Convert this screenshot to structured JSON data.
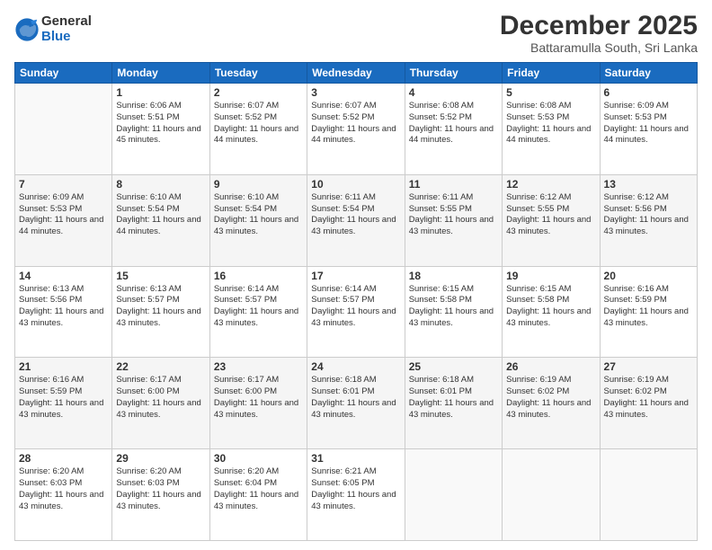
{
  "logo": {
    "general": "General",
    "blue": "Blue"
  },
  "header": {
    "month": "December 2025",
    "location": "Battaramulla South, Sri Lanka"
  },
  "days": [
    "Sunday",
    "Monday",
    "Tuesday",
    "Wednesday",
    "Thursday",
    "Friday",
    "Saturday"
  ],
  "weeks": [
    [
      {
        "day": "",
        "sunrise": "",
        "sunset": "",
        "daylight": ""
      },
      {
        "day": "1",
        "sunrise": "6:06 AM",
        "sunset": "5:51 PM",
        "daylight": "11 hours and 45 minutes."
      },
      {
        "day": "2",
        "sunrise": "6:07 AM",
        "sunset": "5:52 PM",
        "daylight": "11 hours and 44 minutes."
      },
      {
        "day": "3",
        "sunrise": "6:07 AM",
        "sunset": "5:52 PM",
        "daylight": "11 hours and 44 minutes."
      },
      {
        "day": "4",
        "sunrise": "6:08 AM",
        "sunset": "5:52 PM",
        "daylight": "11 hours and 44 minutes."
      },
      {
        "day": "5",
        "sunrise": "6:08 AM",
        "sunset": "5:53 PM",
        "daylight": "11 hours and 44 minutes."
      },
      {
        "day": "6",
        "sunrise": "6:09 AM",
        "sunset": "5:53 PM",
        "daylight": "11 hours and 44 minutes."
      }
    ],
    [
      {
        "day": "7",
        "sunrise": "6:09 AM",
        "sunset": "5:53 PM",
        "daylight": "11 hours and 44 minutes."
      },
      {
        "day": "8",
        "sunrise": "6:10 AM",
        "sunset": "5:54 PM",
        "daylight": "11 hours and 44 minutes."
      },
      {
        "day": "9",
        "sunrise": "6:10 AM",
        "sunset": "5:54 PM",
        "daylight": "11 hours and 43 minutes."
      },
      {
        "day": "10",
        "sunrise": "6:11 AM",
        "sunset": "5:54 PM",
        "daylight": "11 hours and 43 minutes."
      },
      {
        "day": "11",
        "sunrise": "6:11 AM",
        "sunset": "5:55 PM",
        "daylight": "11 hours and 43 minutes."
      },
      {
        "day": "12",
        "sunrise": "6:12 AM",
        "sunset": "5:55 PM",
        "daylight": "11 hours and 43 minutes."
      },
      {
        "day": "13",
        "sunrise": "6:12 AM",
        "sunset": "5:56 PM",
        "daylight": "11 hours and 43 minutes."
      }
    ],
    [
      {
        "day": "14",
        "sunrise": "6:13 AM",
        "sunset": "5:56 PM",
        "daylight": "11 hours and 43 minutes."
      },
      {
        "day": "15",
        "sunrise": "6:13 AM",
        "sunset": "5:57 PM",
        "daylight": "11 hours and 43 minutes."
      },
      {
        "day": "16",
        "sunrise": "6:14 AM",
        "sunset": "5:57 PM",
        "daylight": "11 hours and 43 minutes."
      },
      {
        "day": "17",
        "sunrise": "6:14 AM",
        "sunset": "5:57 PM",
        "daylight": "11 hours and 43 minutes."
      },
      {
        "day": "18",
        "sunrise": "6:15 AM",
        "sunset": "5:58 PM",
        "daylight": "11 hours and 43 minutes."
      },
      {
        "day": "19",
        "sunrise": "6:15 AM",
        "sunset": "5:58 PM",
        "daylight": "11 hours and 43 minutes."
      },
      {
        "day": "20",
        "sunrise": "6:16 AM",
        "sunset": "5:59 PM",
        "daylight": "11 hours and 43 minutes."
      }
    ],
    [
      {
        "day": "21",
        "sunrise": "6:16 AM",
        "sunset": "5:59 PM",
        "daylight": "11 hours and 43 minutes."
      },
      {
        "day": "22",
        "sunrise": "6:17 AM",
        "sunset": "6:00 PM",
        "daylight": "11 hours and 43 minutes."
      },
      {
        "day": "23",
        "sunrise": "6:17 AM",
        "sunset": "6:00 PM",
        "daylight": "11 hours and 43 minutes."
      },
      {
        "day": "24",
        "sunrise": "6:18 AM",
        "sunset": "6:01 PM",
        "daylight": "11 hours and 43 minutes."
      },
      {
        "day": "25",
        "sunrise": "6:18 AM",
        "sunset": "6:01 PM",
        "daylight": "11 hours and 43 minutes."
      },
      {
        "day": "26",
        "sunrise": "6:19 AM",
        "sunset": "6:02 PM",
        "daylight": "11 hours and 43 minutes."
      },
      {
        "day": "27",
        "sunrise": "6:19 AM",
        "sunset": "6:02 PM",
        "daylight": "11 hours and 43 minutes."
      }
    ],
    [
      {
        "day": "28",
        "sunrise": "6:20 AM",
        "sunset": "6:03 PM",
        "daylight": "11 hours and 43 minutes."
      },
      {
        "day": "29",
        "sunrise": "6:20 AM",
        "sunset": "6:03 PM",
        "daylight": "11 hours and 43 minutes."
      },
      {
        "day": "30",
        "sunrise": "6:20 AM",
        "sunset": "6:04 PM",
        "daylight": "11 hours and 43 minutes."
      },
      {
        "day": "31",
        "sunrise": "6:21 AM",
        "sunset": "6:05 PM",
        "daylight": "11 hours and 43 minutes."
      },
      {
        "day": "",
        "sunrise": "",
        "sunset": "",
        "daylight": ""
      },
      {
        "day": "",
        "sunrise": "",
        "sunset": "",
        "daylight": ""
      },
      {
        "day": "",
        "sunrise": "",
        "sunset": "",
        "daylight": ""
      }
    ]
  ],
  "labels": {
    "sunrise": "Sunrise:",
    "sunset": "Sunset:",
    "daylight": "Daylight:"
  }
}
